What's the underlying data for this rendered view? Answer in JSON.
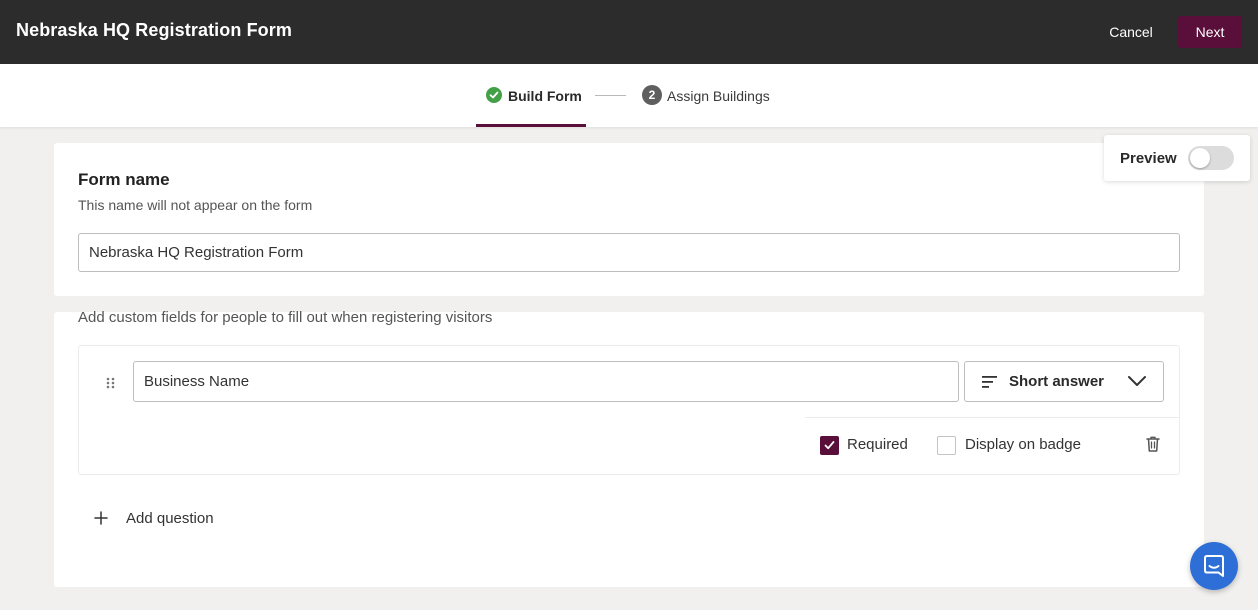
{
  "header": {
    "title": "Nebraska HQ Registration Form",
    "cancel_label": "Cancel",
    "next_label": "Next"
  },
  "stepper": {
    "steps": [
      {
        "label": "Build Form",
        "state": "complete",
        "icon": "check-icon"
      },
      {
        "number": "2",
        "label": "Assign Buildings",
        "state": "upcoming"
      }
    ]
  },
  "preview": {
    "label": "Preview",
    "enabled": false
  },
  "form_name": {
    "title": "Form name",
    "subtitle": "This name will not appear on the form",
    "value": "Nebraska HQ Registration Form"
  },
  "custom_fields": {
    "description": "Add custom fields for people to fill out when registering visitors",
    "questions": [
      {
        "value": "Business Name",
        "type_label": "Short answer",
        "required_label": "Required",
        "required": true,
        "badge_label": "Display on badge",
        "display_on_badge": false
      }
    ],
    "add_question_label": "Add question"
  },
  "colors": {
    "header_bg": "#2c2c2c",
    "brand": "#5a0e3a",
    "success": "#43a047",
    "chat": "#2d6fd6"
  }
}
